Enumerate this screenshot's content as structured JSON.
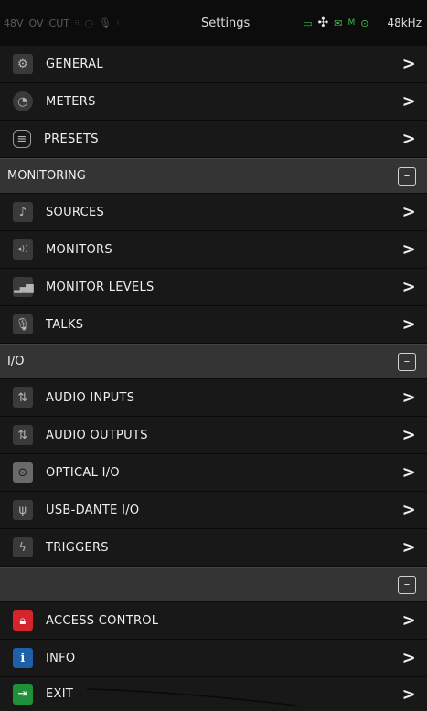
{
  "status": {
    "left_items": [
      "48V",
      "OV",
      "CUT"
    ],
    "title": "Settings",
    "flag": "M",
    "rate": "48kHz"
  },
  "rows": {
    "general": "GENERAL",
    "meters": "METERS",
    "presets": "PRESETS",
    "monitoring_section": "MONITORING",
    "sources": "SOURCES",
    "monitors": "MONITORS",
    "monitor_levels": "MONITOR LEVELS",
    "talks": "TALKS",
    "io_section": "I/O",
    "audio_inputs": "AUDIO INPUTS",
    "audio_outputs": "AUDIO OUTPUTS",
    "optical_io": "OPTICAL I/O",
    "usb_dante_io": "USB-DANTE I/O",
    "triggers": "TRIGGERS",
    "blank_section": "",
    "access_control": "ACCESS CONTROL",
    "info": "INFO",
    "exit": "EXIT"
  },
  "glyphs": {
    "chevron": ">",
    "collapse": "–",
    "info": "i"
  },
  "colors": {
    "access_icon": "#d4252c",
    "info_icon": "#1d5fa8",
    "exit_icon": "#1f8f3a",
    "status_ok": "#37c043"
  }
}
